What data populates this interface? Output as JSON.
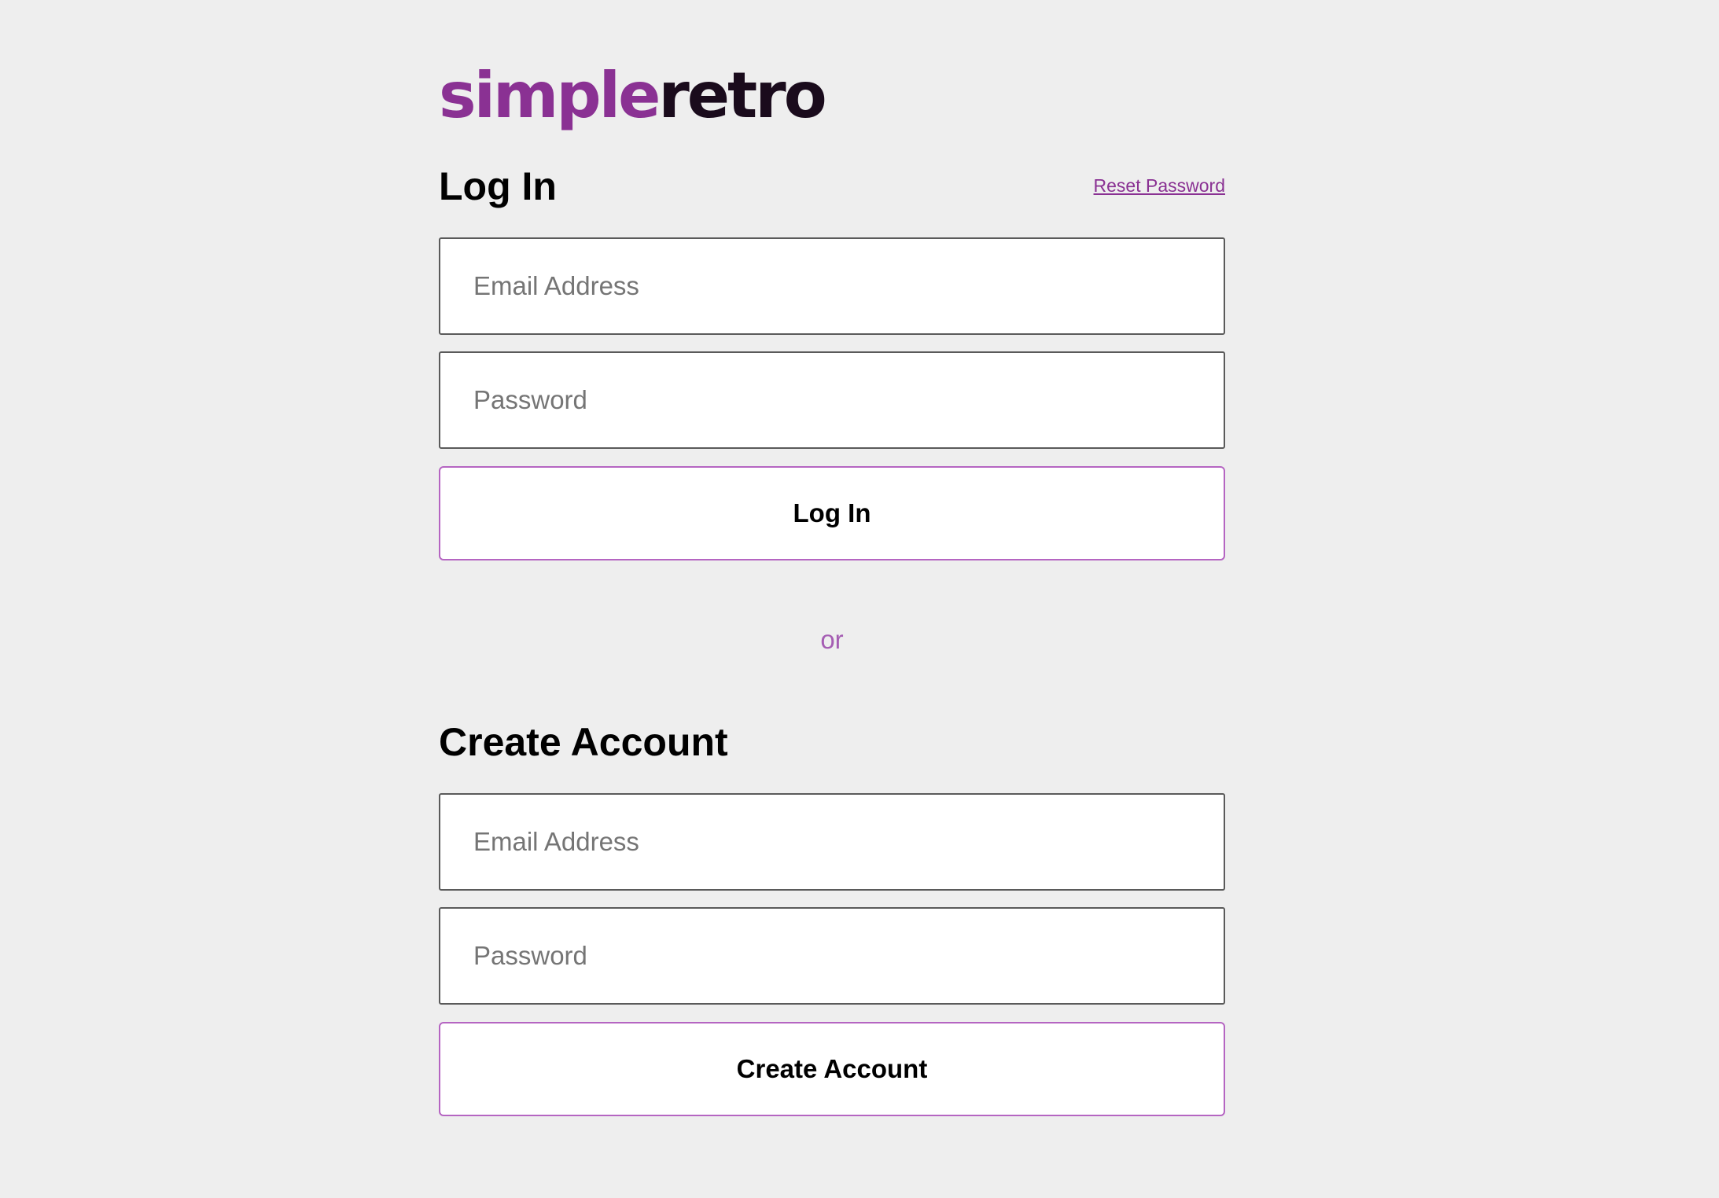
{
  "logo": {
    "part1": "simple",
    "part2": "retro"
  },
  "login": {
    "title": "Log In",
    "reset_link": "Reset Password",
    "email_placeholder": "Email Address",
    "password_placeholder": "Password",
    "submit_label": "Log In"
  },
  "separator": "or",
  "create": {
    "title": "Create Account",
    "email_placeholder": "Email Address",
    "password_placeholder": "Password",
    "submit_label": "Create Account"
  },
  "colors": {
    "background": "#eeeeee",
    "brand_purple": "#8a3193",
    "brand_dark": "#1a0b1c",
    "button_border": "#b565c2",
    "or_text": "#a55db3"
  }
}
